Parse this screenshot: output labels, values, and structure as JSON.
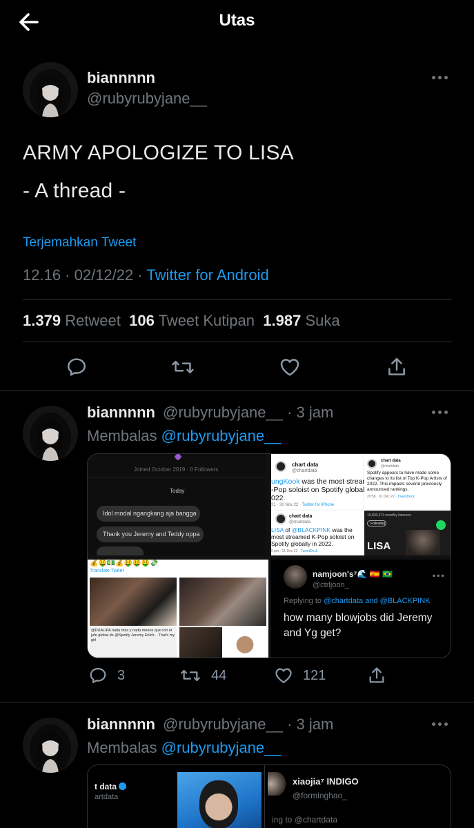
{
  "header": {
    "title": "Utas"
  },
  "main_tweet": {
    "name": "biannnnn",
    "handle": "@rubyrubyjane__",
    "text_line1": "ARMY APOLOGIZE TO LISA",
    "text_line2": "- A thread -",
    "translate": "Terjemahkan Tweet",
    "time": "12.16 · 02/12/22 ·",
    "source": "Twitter for Android",
    "retweets": "1.379",
    "retweets_label": "Retweet",
    "quotes": "106",
    "quotes_label": "Tweet Kutipan",
    "likes": "1.987",
    "likes_label": "Suka"
  },
  "reply1": {
    "name": "biannnnn",
    "handle_time": "@rubyrubyjane__ · 3 jam",
    "replying_prefix": "Membalas",
    "replying_to": "@rubyrubyjane__",
    "reply_count": "3",
    "retweet_count": "44",
    "like_count": "121",
    "media": {
      "tl": {
        "joined": "Joined October 2019 · 0 Followers",
        "today": "Today",
        "msg1": "Idol modal ngangkang aja bangga",
        "msg2": "Thank you Jeremy and Teddy oppa"
      },
      "tr": {
        "acct": "chart data",
        "acct_handle": "@chartdata",
        "t1a": "ungKook",
        "t1b": " was the most streamed",
        "t1c": "-Pop soloist on Spotify globally in",
        "t1d": "022.",
        "t1meta_a": "31 · 30 Nov 22 ·",
        "t1meta_b": "Twitter for iPhone",
        "t2": "Spotify appears to have made some changes to its list of Top K-Pop Artists of 2022. This impacts several previously announced rankings.",
        "t2meta": "20:58 · 01 Dec 22 ·",
        "t2meta_b": "TweetDeck",
        "t3a": "LISA",
        "t3b": " of ",
        "t3c": "@BLACKPINK",
        "t3d": " was the most streamed K-Pop soloist on Spotify globally in 2022.",
        "t3meta_a": "9 pm · 01 Dec 22 ·",
        "t3meta_b": "TweetDeck",
        "listeners": "19,830,474 monthly listeners",
        "following": "Following",
        "lisa": "LISA"
      },
      "bl": {
        "translate": "Translate Tweet",
        "caption": "@DUALIPA nada más y nada menos que con el jefe global de @Spotify Jeremy Erlich... That's my girl"
      },
      "br": {
        "name": "namjoon's⁷🌊 🇪🇸 🇧🇷",
        "handle": "@ctrljoon_",
        "replying": "Replying to",
        "to": "@chartdata and @BLACKPINK",
        "text": "how many blowjobs did Jeremy and Yg get?"
      }
    }
  },
  "reply2": {
    "name": "biannnnn",
    "handle_time": "@rubyrubyjane__ · 3 jam",
    "replying_prefix": "Membalas",
    "replying_to": "@rubyrubyjane__",
    "media": {
      "left_title": "t data",
      "left_handle": "artdata",
      "right_name": "xiaojia⁷ INDIGO",
      "right_handle": "@forminghao_",
      "right_replying": "ing to @chartdata"
    }
  },
  "colors": {
    "accent": "#1d9bf0",
    "muted": "#71767b",
    "text": "#e7e9ea",
    "bg": "#000000"
  }
}
